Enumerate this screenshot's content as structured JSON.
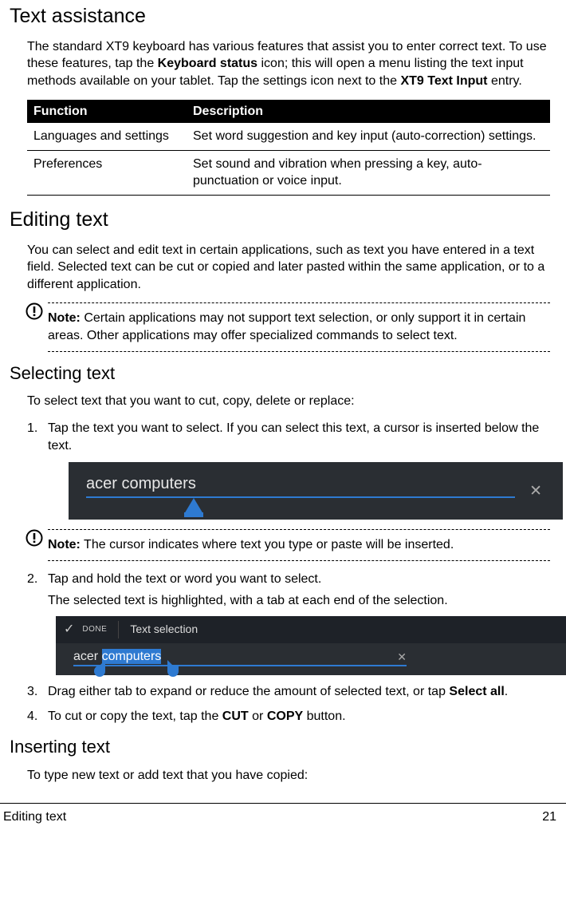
{
  "section1": {
    "heading": "Text assistance",
    "para_html": "The standard XT9 keyboard has various features that assist you to enter correct text. To use these features, tap the <b>Keyboard status</b> icon; this will open a menu listing the text input methods available on your tablet. Tap the settings icon next to the <b>XT9 Text Input</b> entry."
  },
  "table": {
    "h1": "Function",
    "h2": "Description",
    "rows": [
      {
        "c1": "Languages and settings",
        "c2": "Set word suggestion and key input (auto-correction) settings."
      },
      {
        "c1": "Preferences",
        "c2": "Set sound and vibration when pressing a key, auto-punctuation or voice input."
      }
    ]
  },
  "section2": {
    "heading": "Editing text",
    "para": "You can select and edit text in certain applications, such as text you have entered in a text field. Selected text can be cut or copied and later pasted within the same application, or to a different application.",
    "note_html": "<b>Note:</b> Certain applications may not support text selection, or only support it in certain areas. Other applications may offer specialized commands to select text."
  },
  "section3": {
    "heading": "Selecting text",
    "intro": "To select text that you want to cut, copy, delete or replace:",
    "step1": "Tap the text you want to select. If you can select this text, a cursor is inserted below the text.",
    "shot1_text": "acer computers",
    "note2_html": "<b>Note:</b> The cursor indicates where text you type or paste will be inserted.",
    "step2a": "Tap and hold the text or word you want to select.",
    "step2b": "The selected text is highlighted, with a tab at each end of the selection.",
    "shot2_done": "DONE",
    "shot2_title": "Text selection",
    "shot2_pre": "acer ",
    "shot2_sel": "computers",
    "step3_html": "Drag either tab to expand or reduce the amount of selected text, or tap <b>Select all</b>.",
    "step4_html": "To cut or copy the text, tap the <b>CUT</b> or <b>COPY</b> button."
  },
  "section4": {
    "heading": "Inserting text",
    "para": "To type new text or add text that you have copied:"
  },
  "footer": {
    "left": "Editing text",
    "right": "21"
  }
}
